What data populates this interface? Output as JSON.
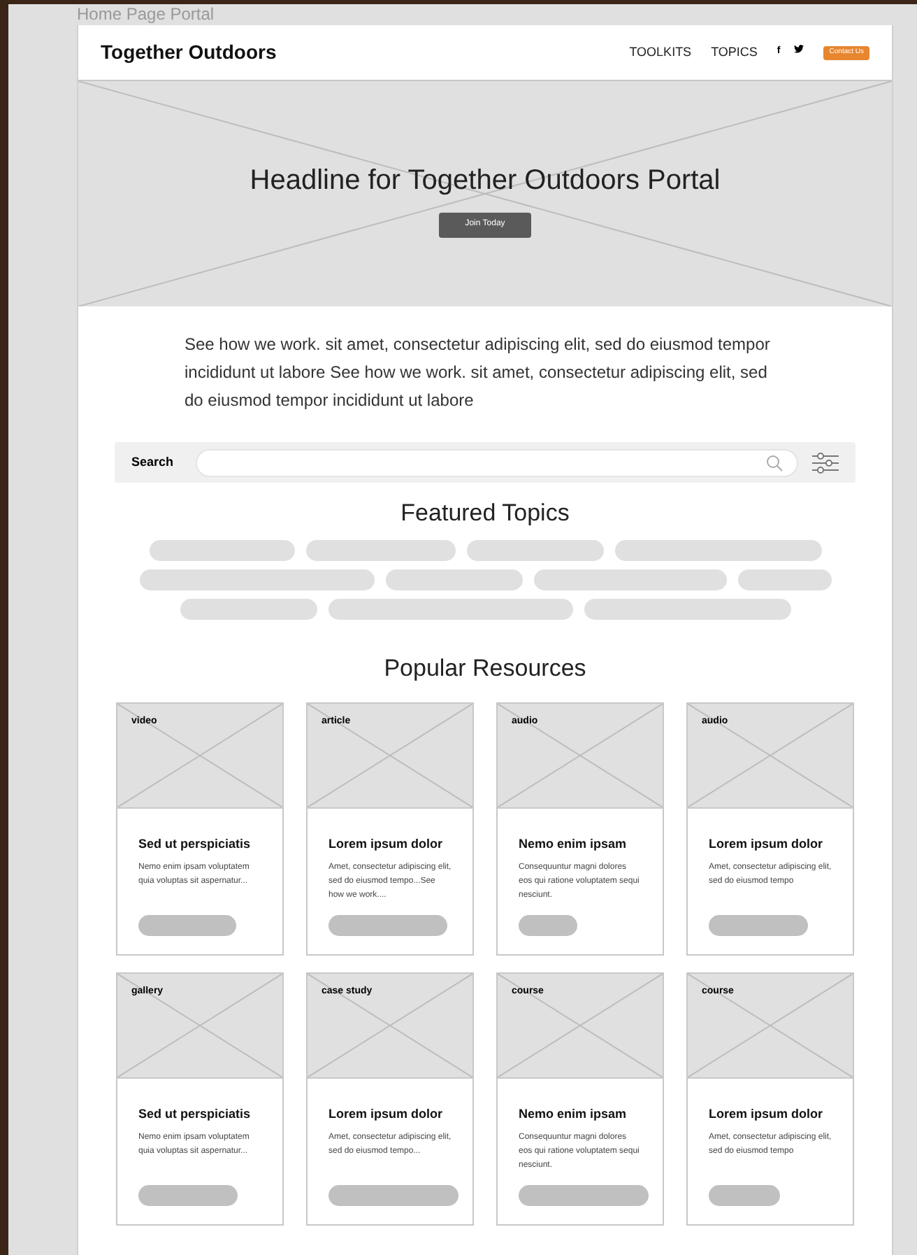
{
  "window": {
    "title": "Home Page Portal"
  },
  "nav": {
    "brand": "Together Outdoors",
    "links": [
      "TOOLKITS",
      "TOPICS"
    ],
    "social": [
      {
        "kind": "letter",
        "text": "f"
      },
      {
        "kind": "bird"
      }
    ],
    "cta": "Contact Us"
  },
  "hero": {
    "headline": "Headline for Together Outdoors Portal",
    "button": "Join Today"
  },
  "intro": "See how we work. sit amet, consectetur adipiscing elit, sed do eiusmod tempor incididunt ut labore See how we work. sit amet, consectetur adipiscing elit, sed do eiusmod tempor incididunt ut labore",
  "search": {
    "label": "Search"
  },
  "featured": {
    "title": "Featured Topics"
  },
  "popular": {
    "title": "Popular Resources",
    "cards": [
      {
        "type": "video",
        "title": "Sed ut perspiciatis",
        "text": "Nemo enim ipsam voluptatem quia voluptas sit aspernatur..."
      },
      {
        "type": "article",
        "title": "Lorem ipsum dolor",
        "text": "Amet, consectetur adipiscing elit, sed do eiusmod tempo...See how we work...."
      },
      {
        "type": "audio",
        "title": "Nemo enim ipsam",
        "text": "Consequuntur magni dolores eos qui ratione voluptatem sequi nesciunt."
      },
      {
        "type": "audio",
        "title": "Lorem ipsum dolor",
        "text": "Amet, consectetur adipiscing elit, sed do eiusmod tempo"
      },
      {
        "type": "gallery",
        "title": "Sed ut perspiciatis",
        "text": "Nemo enim ipsam voluptatem quia voluptas sit aspernatur..."
      },
      {
        "type": "case study",
        "title": "Lorem ipsum dolor",
        "text": "Amet, consectetur adipiscing elit, sed do eiusmod tempo..."
      },
      {
        "type": "course",
        "title": "Nemo enim ipsam",
        "text": "Consequuntur magni dolores eos qui ratione voluptatem sequi nesciunt."
      },
      {
        "type": "course",
        "title": "Lorem ipsum dolor",
        "text": "Amet, consectetur adipiscing elit, sed do eiusmod tempo"
      }
    ]
  }
}
